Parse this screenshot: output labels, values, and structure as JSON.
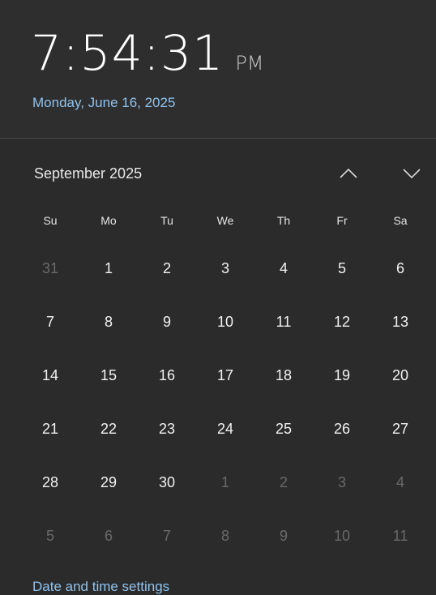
{
  "clock": {
    "time": "7:54:31",
    "ampm": "PM",
    "long_date": "Monday, June 16, 2025"
  },
  "calendar": {
    "month_label": "September 2025",
    "nav_up_icon": "chevron-up-icon",
    "nav_down_icon": "chevron-down-icon",
    "weekdays": [
      "Su",
      "Mo",
      "Tu",
      "We",
      "Th",
      "Fr",
      "Sa"
    ],
    "days": [
      {
        "label": "31",
        "in_month": false
      },
      {
        "label": "1",
        "in_month": true
      },
      {
        "label": "2",
        "in_month": true
      },
      {
        "label": "3",
        "in_month": true
      },
      {
        "label": "4",
        "in_month": true
      },
      {
        "label": "5",
        "in_month": true
      },
      {
        "label": "6",
        "in_month": true
      },
      {
        "label": "7",
        "in_month": true
      },
      {
        "label": "8",
        "in_month": true
      },
      {
        "label": "9",
        "in_month": true
      },
      {
        "label": "10",
        "in_month": true
      },
      {
        "label": "11",
        "in_month": true
      },
      {
        "label": "12",
        "in_month": true
      },
      {
        "label": "13",
        "in_month": true
      },
      {
        "label": "14",
        "in_month": true
      },
      {
        "label": "15",
        "in_month": true
      },
      {
        "label": "16",
        "in_month": true
      },
      {
        "label": "17",
        "in_month": true
      },
      {
        "label": "18",
        "in_month": true
      },
      {
        "label": "19",
        "in_month": true
      },
      {
        "label": "20",
        "in_month": true
      },
      {
        "label": "21",
        "in_month": true
      },
      {
        "label": "22",
        "in_month": true
      },
      {
        "label": "23",
        "in_month": true
      },
      {
        "label": "24",
        "in_month": true
      },
      {
        "label": "25",
        "in_month": true
      },
      {
        "label": "26",
        "in_month": true
      },
      {
        "label": "27",
        "in_month": true
      },
      {
        "label": "28",
        "in_month": true
      },
      {
        "label": "29",
        "in_month": true
      },
      {
        "label": "30",
        "in_month": true
      },
      {
        "label": "1",
        "in_month": false
      },
      {
        "label": "2",
        "in_month": false
      },
      {
        "label": "3",
        "in_month": false
      },
      {
        "label": "4",
        "in_month": false
      },
      {
        "label": "5",
        "in_month": false
      },
      {
        "label": "6",
        "in_month": false
      },
      {
        "label": "7",
        "in_month": false
      },
      {
        "label": "8",
        "in_month": false
      },
      {
        "label": "9",
        "in_month": false
      },
      {
        "label": "10",
        "in_month": false
      },
      {
        "label": "11",
        "in_month": false
      }
    ]
  },
  "footer": {
    "settings_link": "Date and time settings"
  },
  "colors": {
    "background": "#2b2b2b",
    "accent_link": "#8fc3ee",
    "text": "#f2f2f2",
    "dim_text": "#6a6a6a"
  }
}
